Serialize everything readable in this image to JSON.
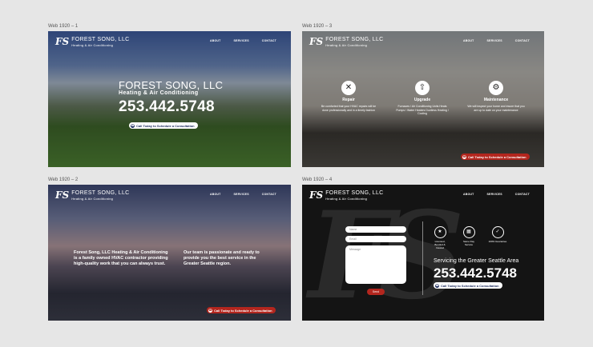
{
  "frames": [
    {
      "label": "Web 1920 – 1"
    },
    {
      "label": "Web 1920 – 3"
    },
    {
      "label": "Web 1920 – 2"
    },
    {
      "label": "Web 1920 – 4"
    }
  ],
  "brand": {
    "mark": "FS",
    "name": "FOREST SONG, LLC",
    "tagline": "Heating & Air Conditioning"
  },
  "nav": [
    "ABOUT",
    "SERVICES",
    "CONTACT"
  ],
  "hero": {
    "name": "FOREST SONG, LLC",
    "sub": "Heating & Air Conditioning",
    "phone": "253.442.5748",
    "cta": "Call Today to Schedule a Consultation"
  },
  "services": [
    {
      "icon": "wrench-icon",
      "glyph": "✕",
      "title": "Repair",
      "desc": "Be comforted that your HVAC repairs will be done professionally and in a timely fashion"
    },
    {
      "icon": "upgrade-arrow-icon",
      "glyph": "⇧",
      "title": "Upgrade",
      "desc": "Furnaces / Air Conditioning Units Heats Pumps / Water Heaters Ductless Heating / Cooling"
    },
    {
      "icon": "maintenance-icon",
      "glyph": "⚙",
      "title": "Maintenance",
      "desc": "We will inspect your home and insure that you are up to date on your maintenance"
    }
  ],
  "about": {
    "left": "Forest Song, LLC Heating & Air Conditioning is a family owned HVAC contractor providing high-quality work that you can always trust.",
    "right": "Our team is passionate and ready to provide you the best service in the Greater Seattle region."
  },
  "contact": {
    "watermark": "FS",
    "fields": {
      "name": "Name",
      "email": "Email",
      "message": "Message"
    },
    "send": "Send",
    "badges": [
      {
        "icon": "license-badge-icon",
        "glyph": "★",
        "label": "Licensed, Bonded & Insured"
      },
      {
        "icon": "calendar-icon",
        "glyph": "▦",
        "label": "Same Day Service"
      },
      {
        "icon": "guarantee-shield-icon",
        "glyph": "✓",
        "label": "100% Guarantee"
      }
    ],
    "service_area": "Servicing the Greater Seattle Area",
    "phone": "253.442.5748",
    "cta": "Call Today to Schedule a Consultation"
  }
}
